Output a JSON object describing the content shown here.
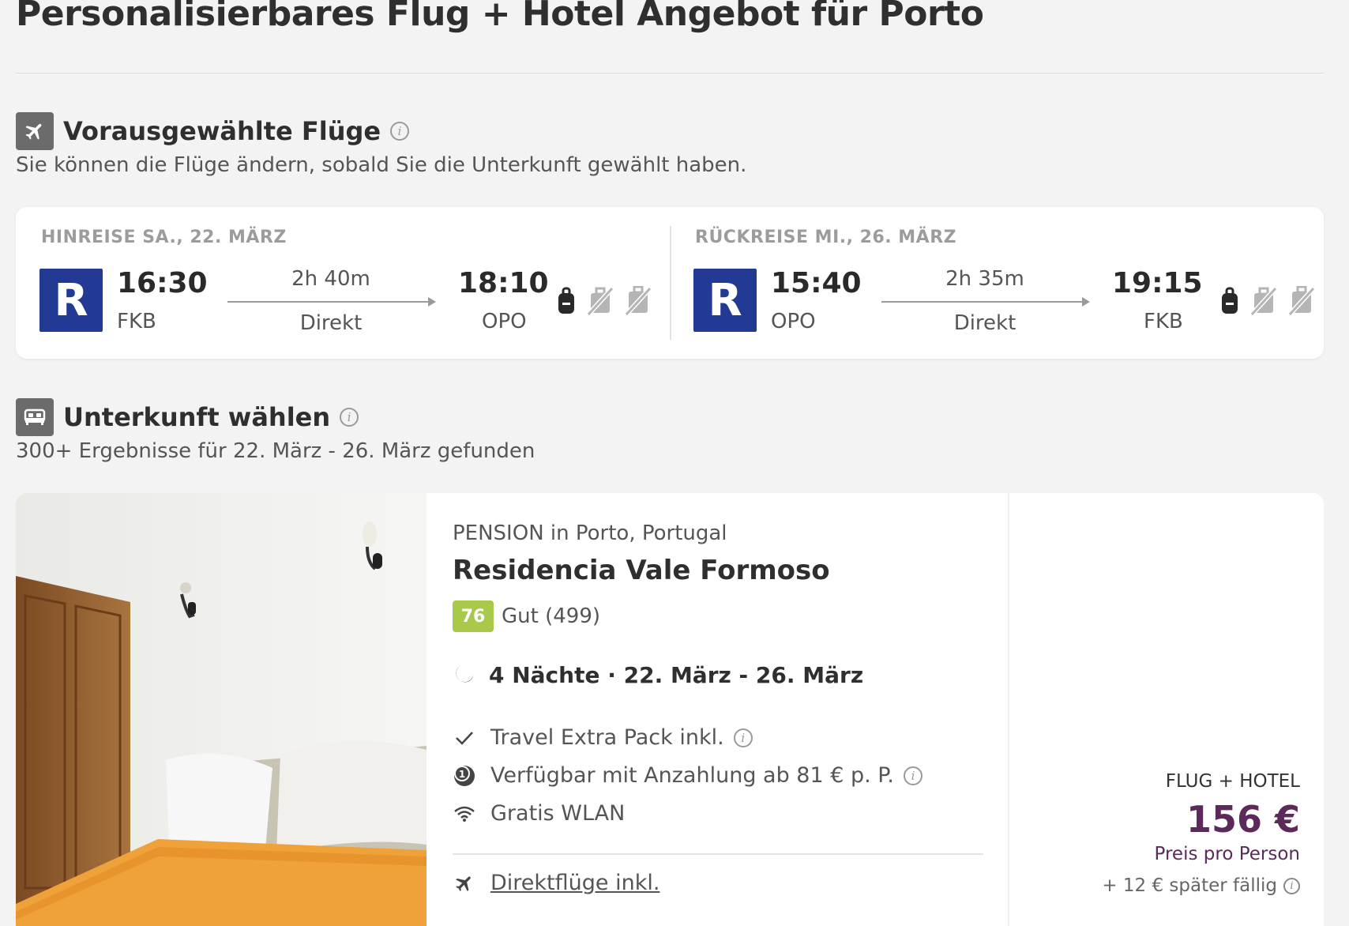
{
  "page": {
    "title": "Personalisierbares Flug + Hotel Angebot für Porto"
  },
  "flights_section": {
    "icon": "airplane-icon",
    "title": "Vorausgewählte Flüge",
    "subtitle": "Sie können die Flüge ändern, sobald Sie die Unterkunft gewählt haben."
  },
  "legs": [
    {
      "label": "HINREISE SA., 22. MÄRZ",
      "airline_letter": "R",
      "departure_time": "16:30",
      "departure_airport": "FKB",
      "duration": "2h 40m",
      "stops": "Direkt",
      "arrival_time": "18:10",
      "arrival_airport": "OPO",
      "baggage_icons": [
        "backpack-icon",
        "no-cabin-bag-icon",
        "no-checked-bag-icon"
      ]
    },
    {
      "label": "RÜCKREISE MI., 26. MÄRZ",
      "airline_letter": "R",
      "departure_time": "15:40",
      "departure_airport": "OPO",
      "duration": "2h 35m",
      "stops": "Direkt",
      "arrival_time": "19:15",
      "arrival_airport": "FKB",
      "baggage_icons": [
        "backpack-icon",
        "no-cabin-bag-icon",
        "no-checked-bag-icon"
      ]
    }
  ],
  "accommodation_section": {
    "icon": "bed-icon",
    "title": "Unterkunft wählen",
    "subtitle": "300+ Ergebnisse für 22. März - 26. März gefunden"
  },
  "hotel": {
    "type": "PENSION in Porto, Portugal",
    "name": "Residencia Vale Formoso",
    "rating_score": "76",
    "rating_text": "Gut (499)",
    "nights": "4 Nächte · 22. März - 26. März",
    "features": [
      {
        "icon": "check-icon",
        "text": "Travel Extra Pack inkl."
      },
      {
        "icon": "deposit-icon",
        "text": "Verfügbar mit Anzahlung ab 81 € p. P."
      },
      {
        "icon": "wifi-icon",
        "text": "Gratis WLAN"
      }
    ],
    "direct_flights_link": "Direktflüge inkl."
  },
  "price": {
    "label": "FLUG + HOTEL",
    "value": "156 €",
    "per_person": "Preis pro Person",
    "later": "+ 12 € später fällig"
  },
  "colors": {
    "background": "#f3f3f3",
    "airline": "#233a94",
    "rating": "#a9c94a",
    "price": "#5b2a5a"
  }
}
